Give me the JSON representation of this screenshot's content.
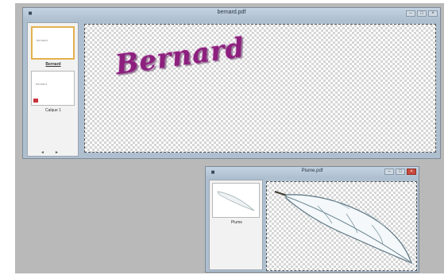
{
  "windows": {
    "bernard": {
      "title": "bernard.pdf",
      "layers": [
        {
          "label": "Bernard",
          "thumb_text": "bernard"
        },
        {
          "label": "Calque 1",
          "thumb_text": "bernard"
        }
      ],
      "canvas_text": "Bernard",
      "nav": [
        "◄",
        "►"
      ]
    },
    "plume": {
      "title": "Plume.pdf",
      "layers": [
        {
          "label": "Plume"
        }
      ]
    }
  },
  "window_controls": {
    "minimize": "–",
    "maximize": "□",
    "close": "×"
  },
  "colors": {
    "text_fill": "#8d1f7e",
    "close_button": "#c94a3c",
    "window_frame": "#aebfd0"
  }
}
